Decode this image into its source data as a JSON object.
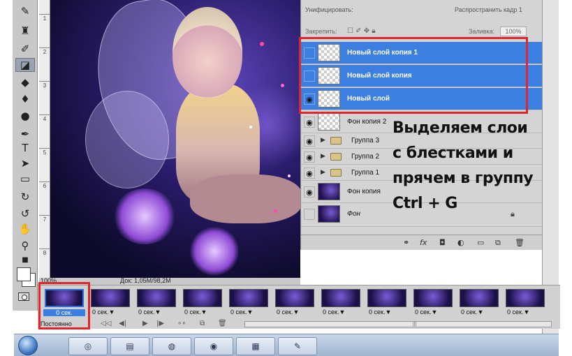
{
  "layers_panel": {
    "top_row_left": "Унифицировать:",
    "top_row_right": "Распространить кадр 1",
    "lock_label": "Закрепить:",
    "fill_label": "Заливка:",
    "fill_value": "100%",
    "layers": [
      {
        "name": "Новый слой копия 1",
        "visible": false,
        "selected": true,
        "thumb": "transparent"
      },
      {
        "name": "Новый слой копия",
        "visible": false,
        "selected": true,
        "thumb": "transparent"
      },
      {
        "name": "Новый слой",
        "visible": true,
        "selected": true,
        "thumb": "transparent"
      },
      {
        "name": "Фон копия 2",
        "visible": true,
        "selected": false,
        "thumb": "transparent"
      }
    ],
    "groups": [
      {
        "name": "Группа 3"
      },
      {
        "name": "Группа 2"
      },
      {
        "name": "Группа 1"
      }
    ],
    "fon_copy": "Фон копия",
    "fon": "Фон"
  },
  "caption": {
    "line1": "Выделяем слои",
    "line2": "с блестками и",
    "line3": "прячем в группу",
    "line4": "Ctrl + G"
  },
  "status_bar": {
    "zoom": "100%",
    "doc": "Док: 1,05M/98,2M"
  },
  "timeline": {
    "frames": [
      {
        "time": "0 сек.",
        "selected": true
      },
      {
        "time": "0 сек.▼",
        "selected": false
      },
      {
        "time": "0 сек.▼",
        "selected": false
      },
      {
        "time": "0 сек.▼",
        "selected": false
      },
      {
        "time": "0 сек.▼",
        "selected": false
      },
      {
        "time": "0 сек.▼",
        "selected": false
      },
      {
        "time": "0 сек.▼",
        "selected": false
      },
      {
        "time": "0 сек.▼",
        "selected": false
      },
      {
        "time": "0 сек.▼",
        "selected": false
      },
      {
        "time": "0 сек.▼",
        "selected": false
      },
      {
        "time": "0 сек.▼",
        "selected": false
      }
    ],
    "loop": "Постоянно"
  },
  "ruler_ticks": [
    "1",
    "2",
    "3",
    "4",
    "5",
    "6",
    "7",
    "8"
  ],
  "colors": {
    "accent": "#3d7fe0",
    "highlight_box": "#e0262b"
  }
}
